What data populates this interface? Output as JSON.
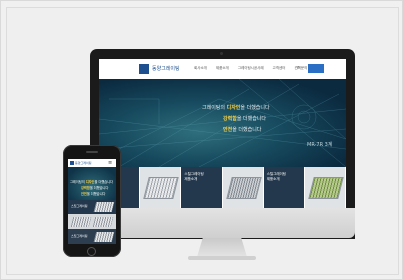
{
  "desktop_site": {
    "brand": "동양그레이팅",
    "nav_items": [
      "회사소개",
      "제품소개",
      "그레이팅시공사례",
      "고객센터",
      "견적문의"
    ],
    "hero": {
      "line1_prefix": "그레이팅의 ",
      "line1_highlight": "디자인",
      "line1_suffix": "을 더했습니다",
      "line2_highlight": "강력함",
      "line2_suffix": "을 더했습니다",
      "line3_highlight": "안전",
      "line3_suffix": "을 더했습니다",
      "mark": "MR-7R 3계"
    },
    "products": [
      {
        "label": "스틸그레이팅\n제품소개"
      },
      {
        "label": ""
      },
      {
        "label": "스틸그레이팅\n제품소개"
      },
      {
        "label": ""
      },
      {
        "label": "스틸그레이팅\n제품소개"
      },
      {
        "label": ""
      }
    ]
  },
  "mobile_site": {
    "brand": "동양그레이팅",
    "hero": {
      "line1_prefix": "그레이팅의 ",
      "line1_highlight": "디자인",
      "line1_suffix": "을 더했습니다",
      "line2_highlight": "강력함",
      "line2_suffix": "을 더했습니다",
      "line3_highlight": "안전",
      "line3_suffix": "을 더했습니다"
    },
    "product_labels": [
      "스틸그레이팅",
      "스틸그레이팅"
    ]
  },
  "icons": {
    "apple": "apple-logo-icon",
    "search": "search-icon",
    "menu": "hamburger-menu-icon"
  },
  "colors": {
    "highlight": "#ffd23f",
    "brand_blue": "#1e4f8f",
    "hero_dark": "#0c2a43"
  }
}
